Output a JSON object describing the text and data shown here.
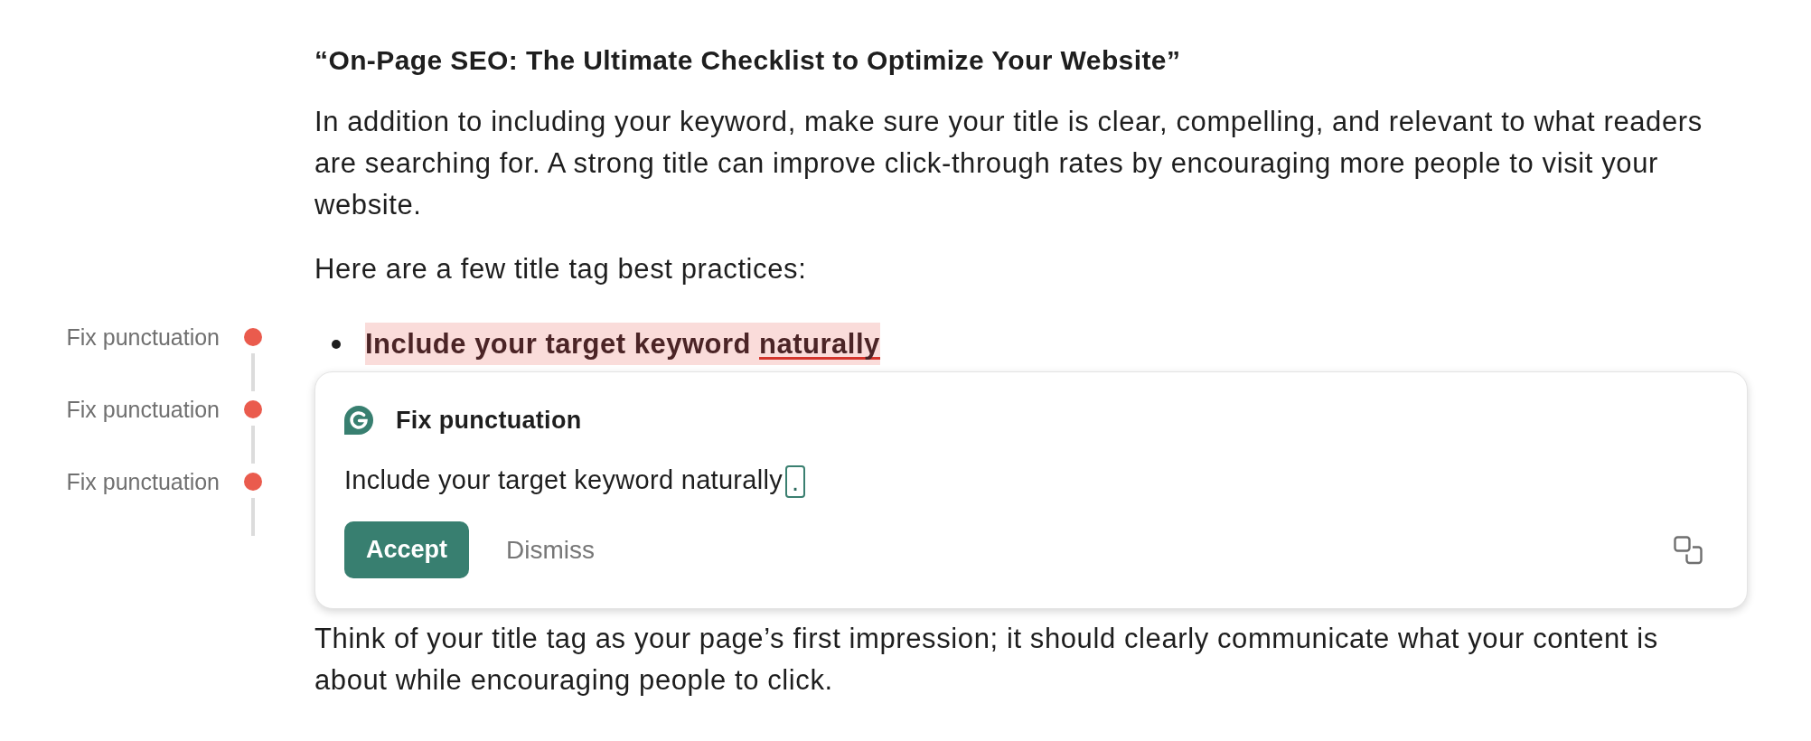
{
  "document": {
    "title": "“On-Page SEO: The Ultimate Checklist to Optimize Your Website”",
    "paragraphs": [
      "In addition to including your keyword, make sure your title is clear, compelling, and relevant to what readers are searching for. A strong title can improve click-through rates by encouraging more people to visit your website.",
      "Here are a few title tag best practices:"
    ],
    "list_items": [
      {
        "highlighted": true,
        "segments": [
          {
            "text": "Include your target keyword ",
            "underlined": false
          },
          {
            "text": "naturally",
            "underlined": true
          }
        ]
      }
    ],
    "closing_paragraph": "Think of your title tag as your page’s first impression; it should clearly communicate what your content is about while encouraging people to click."
  },
  "issues_sidebar": {
    "items": [
      {
        "label": "Fix punctuation"
      },
      {
        "label": "Fix punctuation"
      },
      {
        "label": "Fix punctuation"
      }
    ]
  },
  "suggestion_card": {
    "title": "Fix punctuation",
    "sentence": "Include your target keyword naturally",
    "insertion": ".",
    "buttons": [
      {
        "label": "Accept",
        "kind": "primary"
      },
      {
        "label": "Dismiss",
        "kind": "text"
      }
    ]
  }
}
